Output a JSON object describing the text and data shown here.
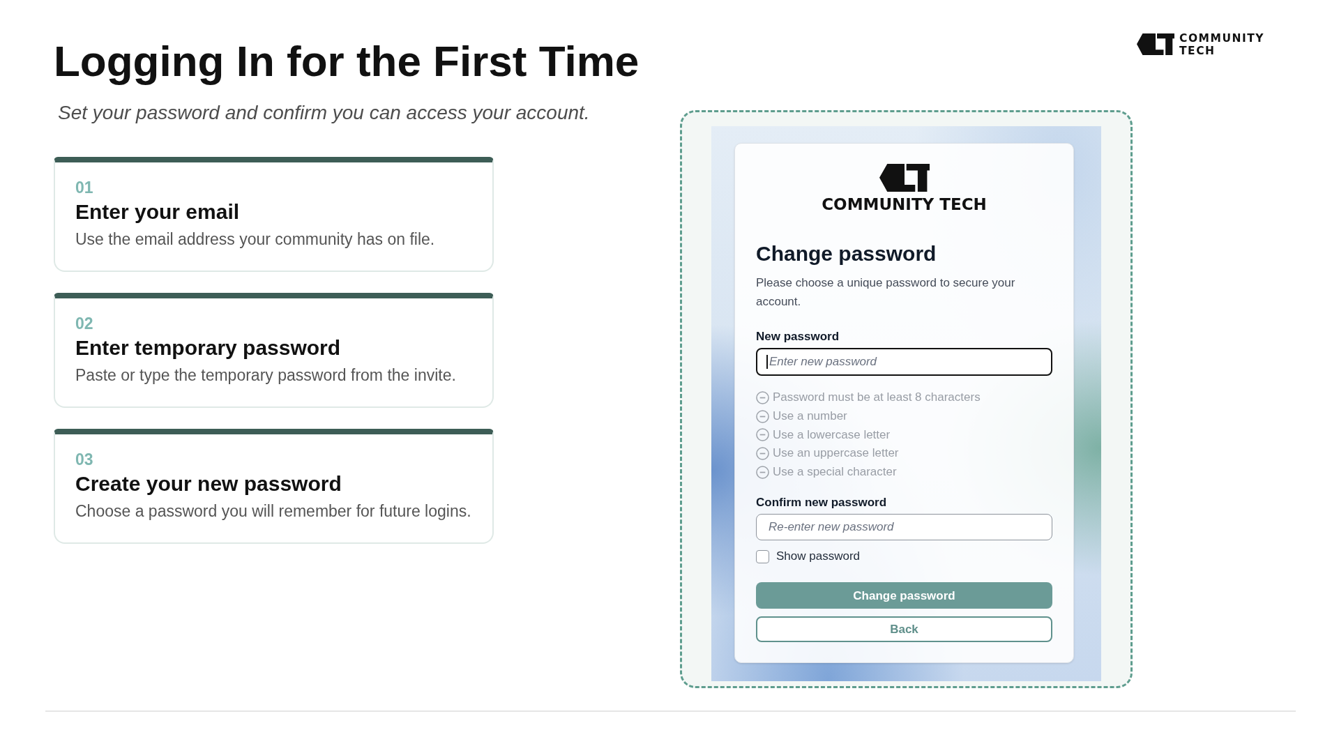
{
  "slide": {
    "title": "Logging In for the First Time",
    "subtitle": "Set your password and confirm you can access your account.",
    "logo_text": "COMMUNITY TECH"
  },
  "steps": [
    {
      "number": "01",
      "title": "Enter your email",
      "description": "Use the email address your community has on file."
    },
    {
      "number": "02",
      "title": "Enter temporary password",
      "description": "Paste or type the temporary password from the invite."
    },
    {
      "number": "03",
      "title": "Create your new password",
      "description": "Choose a password you will remember for future logins."
    }
  ],
  "screenshot": {
    "logo_text": "COMMUNITY TECH",
    "heading": "Change password",
    "description": "Please choose a unique password to secure your account.",
    "fields": [
      {
        "label": "New password",
        "placeholder": "Enter new password",
        "focused": true,
        "requirements": [
          {
            "text": "Password must be at least 8 characters",
            "met": false
          },
          {
            "text": "Use a number",
            "met": false
          },
          {
            "text": "Use a lowercase letter",
            "met": false
          },
          {
            "text": "Use an uppercase letter",
            "met": false
          },
          {
            "text": "Use a special character",
            "met": false
          }
        ]
      },
      {
        "label": "Confirm new password",
        "placeholder": "Re-enter new password",
        "focused": false
      }
    ],
    "show_password": {
      "label": "Show password",
      "checked": false
    },
    "buttons": [
      {
        "label": "Change password",
        "kind": "primary"
      },
      {
        "label": "Back",
        "kind": "secondary"
      }
    ]
  }
}
